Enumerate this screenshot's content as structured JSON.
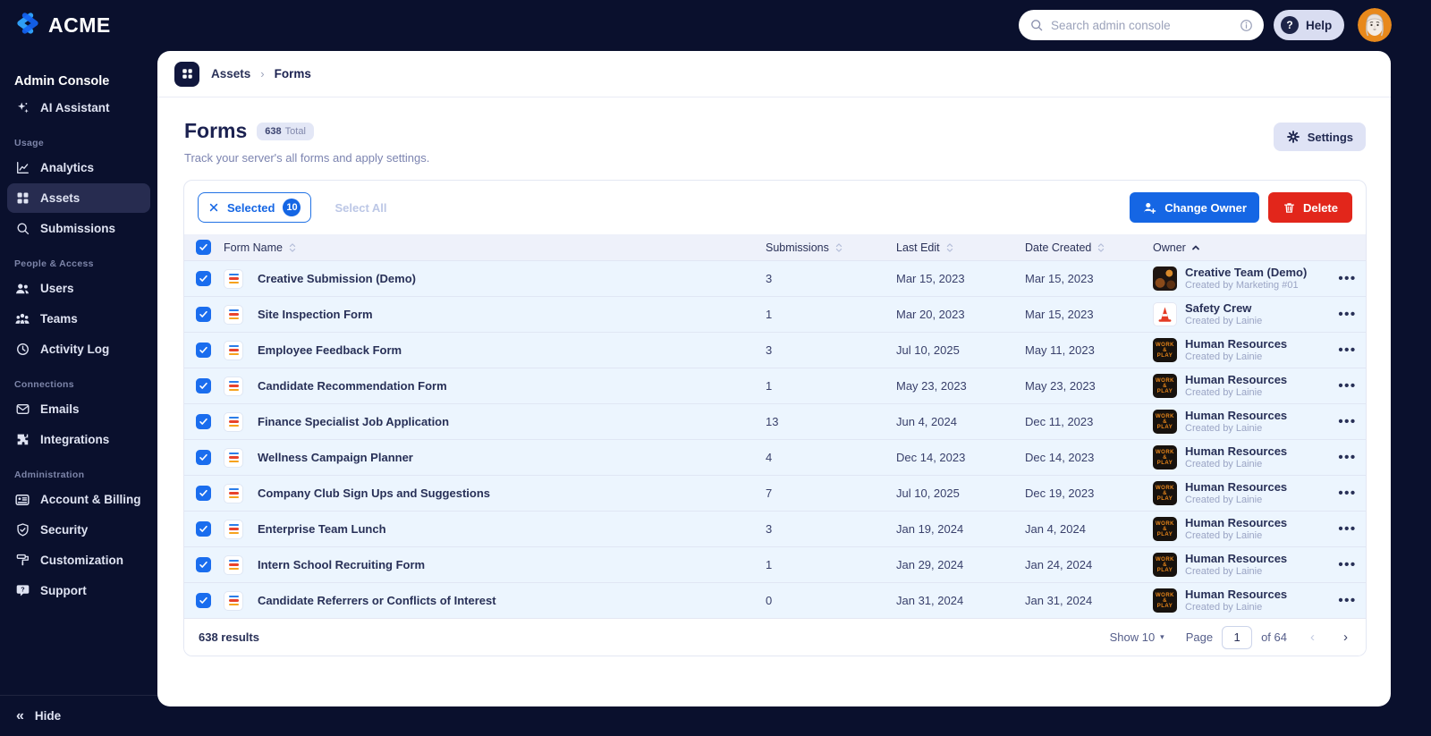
{
  "topbar": {
    "brand": "ACME",
    "search_placeholder": "Search admin console",
    "help_label": "Help"
  },
  "sidebar": {
    "console_label": "Admin Console",
    "hide_label": "Hide",
    "sections": [
      {
        "label": "",
        "items": [
          {
            "label": "AI Assistant",
            "icon": "sparkle",
            "active": false
          }
        ]
      },
      {
        "label": "Usage",
        "items": [
          {
            "label": "Analytics",
            "icon": "chart",
            "active": false
          },
          {
            "label": "Assets",
            "icon": "grid",
            "active": true
          },
          {
            "label": "Submissions",
            "icon": "search",
            "active": false
          }
        ]
      },
      {
        "label": "People & Access",
        "items": [
          {
            "label": "Users",
            "icon": "users",
            "active": false
          },
          {
            "label": "Teams",
            "icon": "teams",
            "active": false
          },
          {
            "label": "Activity Log",
            "icon": "clock",
            "active": false
          }
        ]
      },
      {
        "label": "Connections",
        "items": [
          {
            "label": "Emails",
            "icon": "mail",
            "active": false
          },
          {
            "label": "Integrations",
            "icon": "puzzle",
            "active": false
          }
        ]
      },
      {
        "label": "Administration",
        "items": [
          {
            "label": "Account & Billing",
            "icon": "card",
            "active": false
          },
          {
            "label": "Security",
            "icon": "shield",
            "active": false
          },
          {
            "label": "Customization",
            "icon": "roller",
            "active": false
          },
          {
            "label": "Support",
            "icon": "support",
            "active": false
          }
        ]
      }
    ]
  },
  "breadcrumb": {
    "parent": "Assets",
    "current": "Forms"
  },
  "page": {
    "title": "Forms",
    "total_count": "638",
    "total_suffix": "Total",
    "subtitle": "Track your server's all forms and apply settings.",
    "settings_label": "Settings"
  },
  "toolbar": {
    "selected_label": "Selected",
    "selected_count": "10",
    "select_all_label": "Select All",
    "change_owner_label": "Change Owner",
    "delete_label": "Delete"
  },
  "table": {
    "columns": [
      {
        "label": "Form Name",
        "sorted": "none"
      },
      {
        "label": "Submissions",
        "sorted": "none"
      },
      {
        "label": "Last Edit",
        "sorted": "none"
      },
      {
        "label": "Date Created",
        "sorted": "none"
      },
      {
        "label": "Owner",
        "sorted": "asc"
      }
    ],
    "rows": [
      {
        "name": "Creative Submission (Demo)",
        "submissions": "3",
        "last_edit": "Mar 15, 2023",
        "date_created": "Mar 15, 2023",
        "owner": "Creative Team (Demo)",
        "owner_sub": "Created by Marketing #01",
        "avatar": "creative",
        "checked": true
      },
      {
        "name": "Site Inspection Form",
        "submissions": "1",
        "last_edit": "Mar 20, 2023",
        "date_created": "Mar 15, 2023",
        "owner": "Safety Crew",
        "owner_sub": "Created by Lainie",
        "avatar": "cone",
        "checked": true
      },
      {
        "name": "Employee Feedback Form",
        "submissions": "3",
        "last_edit": "Jul 10, 2025",
        "date_created": "May 11, 2023",
        "owner": "Human Resources",
        "owner_sub": "Created by Lainie",
        "avatar": "hr",
        "checked": true
      },
      {
        "name": "Candidate Recommendation Form",
        "submissions": "1",
        "last_edit": "May 23, 2023",
        "date_created": "May 23, 2023",
        "owner": "Human Resources",
        "owner_sub": "Created by Lainie",
        "avatar": "hr",
        "checked": true
      },
      {
        "name": "Finance Specialist Job Application",
        "submissions": "13",
        "last_edit": "Jun 4, 2024",
        "date_created": "Dec 11, 2023",
        "owner": "Human Resources",
        "owner_sub": "Created by Lainie",
        "avatar": "hr",
        "checked": true
      },
      {
        "name": "Wellness Campaign Planner",
        "submissions": "4",
        "last_edit": "Dec 14, 2023",
        "date_created": "Dec 14, 2023",
        "owner": "Human Resources",
        "owner_sub": "Created by Lainie",
        "avatar": "hr",
        "checked": true
      },
      {
        "name": "Company Club Sign Ups and Suggestions",
        "submissions": "7",
        "last_edit": "Jul 10, 2025",
        "date_created": "Dec 19, 2023",
        "owner": "Human Resources",
        "owner_sub": "Created by Lainie",
        "avatar": "hr",
        "checked": true
      },
      {
        "name": "Enterprise Team Lunch",
        "submissions": "3",
        "last_edit": "Jan 19, 2024",
        "date_created": "Jan 4, 2024",
        "owner": "Human Resources",
        "owner_sub": "Created by Lainie",
        "avatar": "hr",
        "checked": true
      },
      {
        "name": "Intern School Recruiting Form",
        "submissions": "1",
        "last_edit": "Jan 29, 2024",
        "date_created": "Jan 24, 2024",
        "owner": "Human Resources",
        "owner_sub": "Created by Lainie",
        "avatar": "hr",
        "checked": true
      },
      {
        "name": "Candidate Referrers or Conflicts of Interest",
        "submissions": "0",
        "last_edit": "Jan 31, 2024",
        "date_created": "Jan 31, 2024",
        "owner": "Human Resources",
        "owner_sub": "Created by Lainie",
        "avatar": "hr",
        "checked": true
      }
    ]
  },
  "footer": {
    "results_label": "638 results",
    "show_label": "Show 10",
    "page_label": "Page",
    "page_value": "1",
    "of_label": "of 64"
  },
  "colors": {
    "accent_blue": "#1566E4",
    "danger_red": "#E2261B",
    "sidebar_bg": "#0A102D",
    "selected_row_bg": "#ECF5FE",
    "header_row_bg": "#EEF1FA",
    "badge_bg": "#E3E7F6",
    "avatar_ring_orange": "#E8891C",
    "logo_blue_light": "#2F9EF6",
    "logo_blue_dark": "#1464F4"
  }
}
